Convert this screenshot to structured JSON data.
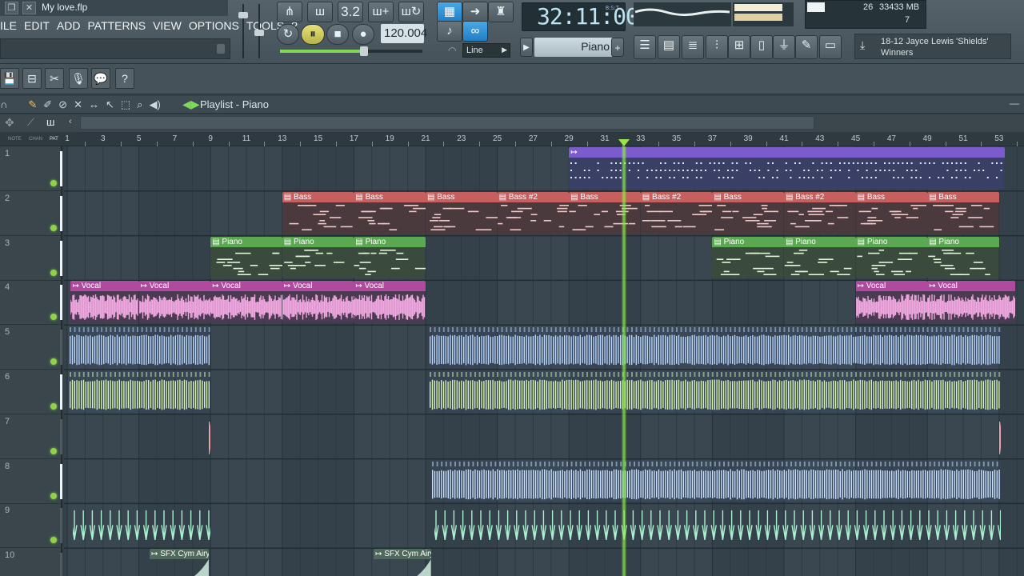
{
  "window": {
    "title": "My love.flp"
  },
  "menu": [
    "ILE",
    "EDIT",
    "ADD",
    "PATTERNS",
    "VIEW",
    "OPTIONS",
    "TOOLS",
    "?"
  ],
  "transport": {
    "pattern_num": "3.2",
    "tempo": "120.004",
    "time": "32:11:00",
    "time_mode": "B:S:T",
    "snap": "Line"
  },
  "monitor": {
    "cpu": "26",
    "memory": "33433 MB",
    "polyphony": "7"
  },
  "channel": {
    "name": "Piano"
  },
  "news": {
    "line1": "18-12  Jayce Lewis 'Shields'",
    "line2": "Winners"
  },
  "playlist": {
    "title": "Playlist - Piano",
    "row_labels": [
      "NOTE",
      "CHAN",
      "PAT"
    ]
  },
  "ruler": [
    "1",
    "3",
    "5",
    "7",
    "9",
    "11",
    "13",
    "15",
    "17",
    "19",
    "21",
    "23",
    "25",
    "27",
    "29",
    "31",
    "33",
    "35",
    "37",
    "39",
    "41",
    "43",
    "45",
    "47",
    "49",
    "51",
    "53"
  ],
  "tracks": [
    "1",
    "2",
    "3",
    "4",
    "5",
    "6",
    "7",
    "8",
    "9",
    "10"
  ],
  "clips": [
    {
      "track": 1,
      "start": 29,
      "end": 53.3,
      "label": "",
      "color": "#7c5ccc",
      "kind": "dots"
    },
    {
      "track": 2,
      "start": 13,
      "end": 17,
      "label": "Bass",
      "color": "#c85f5f",
      "kind": "notes"
    },
    {
      "track": 2,
      "start": 17,
      "end": 21,
      "label": "Bass",
      "color": "#c85f5f",
      "kind": "notes"
    },
    {
      "track": 2,
      "start": 21,
      "end": 25,
      "label": "Bass",
      "color": "#c85f5f",
      "kind": "notes"
    },
    {
      "track": 2,
      "start": 25,
      "end": 29,
      "label": "Bass #2",
      "color": "#c85f5f",
      "kind": "notes"
    },
    {
      "track": 2,
      "start": 29,
      "end": 33,
      "label": "Bass",
      "color": "#c85f5f",
      "kind": "notes"
    },
    {
      "track": 2,
      "start": 33,
      "end": 37,
      "label": "Bass #2",
      "color": "#c85f5f",
      "kind": "notes"
    },
    {
      "track": 2,
      "start": 37,
      "end": 41,
      "label": "Bass",
      "color": "#c85f5f",
      "kind": "notes"
    },
    {
      "track": 2,
      "start": 41,
      "end": 45,
      "label": "Bass #2",
      "color": "#c85f5f",
      "kind": "notes"
    },
    {
      "track": 2,
      "start": 45,
      "end": 49,
      "label": "Bass",
      "color": "#c85f5f",
      "kind": "notes"
    },
    {
      "track": 2,
      "start": 49,
      "end": 53,
      "label": "Bass",
      "color": "#c85f5f",
      "kind": "notes"
    },
    {
      "track": 3,
      "start": 9,
      "end": 13,
      "label": "Piano",
      "color": "#5aa84f",
      "kind": "notes"
    },
    {
      "track": 3,
      "start": 13,
      "end": 17,
      "label": "Piano",
      "color": "#5aa84f",
      "kind": "notes"
    },
    {
      "track": 3,
      "start": 17,
      "end": 21,
      "label": "Piano",
      "color": "#5aa84f",
      "kind": "notes"
    },
    {
      "track": 3,
      "start": 37,
      "end": 41,
      "label": "Piano",
      "color": "#5aa84f",
      "kind": "notes"
    },
    {
      "track": 3,
      "start": 41,
      "end": 45,
      "label": "Piano",
      "color": "#5aa84f",
      "kind": "notes"
    },
    {
      "track": 3,
      "start": 45,
      "end": 49,
      "label": "Piano",
      "color": "#5aa84f",
      "kind": "notes"
    },
    {
      "track": 3,
      "start": 49,
      "end": 53,
      "label": "Piano",
      "color": "#5aa84f",
      "kind": "notes"
    },
    {
      "track": 4,
      "start": 1.2,
      "end": 5,
      "label": "Vocal",
      "color": "#b04a9e",
      "kind": "wave",
      "wave": "#f0a8e0"
    },
    {
      "track": 4,
      "start": 5,
      "end": 9,
      "label": "Vocal",
      "color": "#b04a9e",
      "kind": "wave",
      "wave": "#f0a8e0"
    },
    {
      "track": 4,
      "start": 9,
      "end": 13,
      "label": "Vocal",
      "color": "#b04a9e",
      "kind": "wave",
      "wave": "#f0a8e0"
    },
    {
      "track": 4,
      "start": 13,
      "end": 17,
      "label": "Vocal",
      "color": "#b04a9e",
      "kind": "wave",
      "wave": "#f0a8e0"
    },
    {
      "track": 4,
      "start": 17,
      "end": 21,
      "label": "Vocal",
      "color": "#b04a9e",
      "kind": "wave",
      "wave": "#f0a8e0"
    },
    {
      "track": 4,
      "start": 45,
      "end": 49,
      "label": "Vocal",
      "color": "#b04a9e",
      "kind": "wave",
      "wave": "#f0a8e0"
    },
    {
      "track": 4,
      "start": 49,
      "end": 53.9,
      "label": "Vocal",
      "color": "#b04a9e",
      "kind": "wave",
      "wave": "#f0a8e0"
    },
    {
      "track": 5,
      "start": 1.1,
      "end": 9,
      "label": "",
      "color": "#3c5a80",
      "kind": "bars",
      "wave": "#b8d6ff"
    },
    {
      "track": 5,
      "start": 21.2,
      "end": 53.1,
      "label": "",
      "color": "#3c5a80",
      "kind": "bars",
      "wave": "#b8d6ff"
    },
    {
      "track": 6,
      "start": 1.1,
      "end": 9,
      "label": "",
      "color": "#4a5e44",
      "kind": "bars",
      "wave": "#d8f3b0"
    },
    {
      "track": 6,
      "start": 21.2,
      "end": 53.1,
      "label": "",
      "color": "#4a5e44",
      "kind": "bars",
      "wave": "#d8f3b0"
    },
    {
      "track": 7,
      "start": 8.9,
      "end": 9,
      "label": "",
      "color": "#7a3a40",
      "kind": "spike",
      "wave": "#f2a0a8"
    },
    {
      "track": 7,
      "start": 53,
      "end": 53.1,
      "label": "",
      "color": "#7a3a40",
      "kind": "spike",
      "wave": "#f2a0a8"
    },
    {
      "track": 8,
      "start": 21.3,
      "end": 53.1,
      "label": "",
      "color": "#3c5a80",
      "kind": "bars",
      "wave": "#c8e0ff"
    },
    {
      "track": 9,
      "start": 1.3,
      "end": 9,
      "label": "",
      "color": "#3a5e56",
      "kind": "ticks",
      "wave": "#a8f0d0"
    },
    {
      "track": 9,
      "start": 21.5,
      "end": 53.1,
      "label": "",
      "color": "#3a5e56",
      "kind": "ticks",
      "wave": "#a8f0d0"
    },
    {
      "track": 10,
      "start": 5.6,
      "end": 8.9,
      "label": "SFX Cym Airy",
      "color": "#4f6a5c",
      "kind": "swell",
      "wave": "#d0f0e0"
    },
    {
      "track": 10,
      "start": 18.1,
      "end": 21.3,
      "label": "SFX Cym Airy",
      "color": "#4f6a5c",
      "kind": "swell",
      "wave": "#d0f0e0"
    }
  ],
  "playhead_bar": 32
}
